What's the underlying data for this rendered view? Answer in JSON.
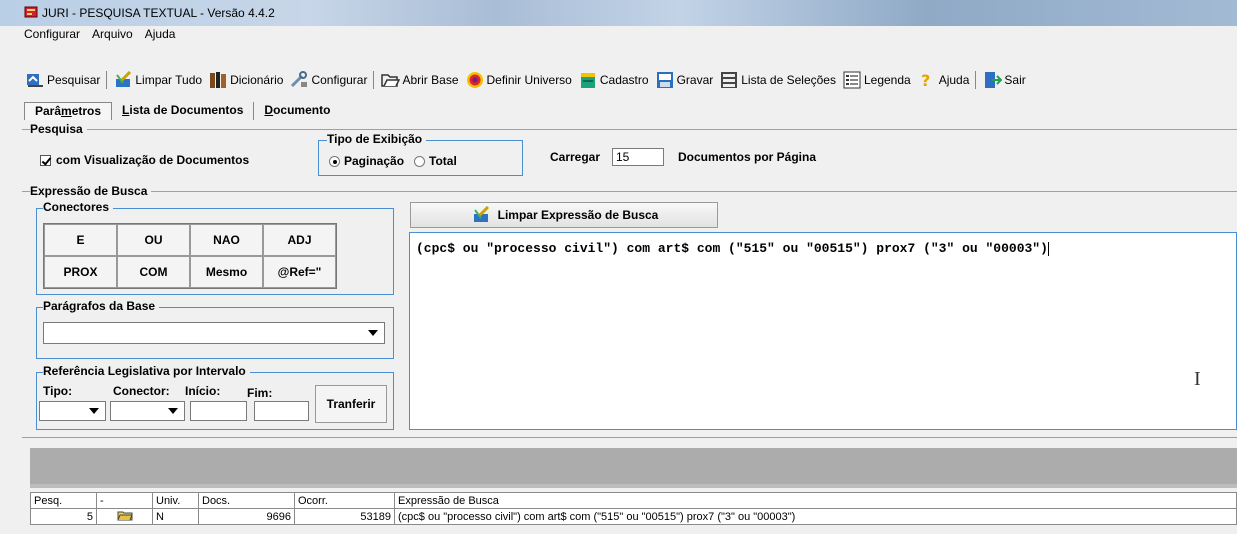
{
  "window": {
    "title": "JURI - PESQUISA TEXTUAL - Versão 4.4.2"
  },
  "menu": [
    "Configurar",
    "Arquivo",
    "Ajuda"
  ],
  "toolbar": [
    {
      "label": "Pesquisar",
      "icon": "search-icon"
    },
    {
      "label": "Limpar Tudo",
      "icon": "broom-icon"
    },
    {
      "label": "Dicionário",
      "icon": "books-icon"
    },
    {
      "label": "Configurar",
      "icon": "tools-icon"
    },
    {
      "label": "Abrir Base",
      "icon": "folder-open-icon"
    },
    {
      "label": "Definir Universo",
      "icon": "target-icon"
    },
    {
      "label": "Cadastro",
      "icon": "cabinet-icon"
    },
    {
      "label": "Gravar",
      "icon": "save-icon"
    },
    {
      "label": "Lista de Seleções",
      "icon": "selection-list-icon"
    },
    {
      "label": "Legenda",
      "icon": "legend-icon"
    },
    {
      "label": "Ajuda",
      "icon": "help-icon"
    },
    {
      "label": "Sair",
      "icon": "exit-icon"
    }
  ],
  "tabs": {
    "parametros": {
      "pre": "Parâ",
      "u": "m",
      "post": "etros"
    },
    "lista": {
      "pre": "",
      "u": "L",
      "post": "ista de Documentos"
    },
    "documento": {
      "pre": "",
      "u": "D",
      "post": "ocumento"
    }
  },
  "pesquisa": {
    "label": "Pesquisa",
    "checkbox_label": "com Visualização de Documentos",
    "checkbox_checked": true,
    "tipo_label": "Tipo de Exibição",
    "radio_paginacao": "Paginação",
    "radio_total": "Total",
    "selected": "Paginação",
    "carregar_label": "Carregar",
    "carregar_value": "15",
    "docs_por_pagina": "Documentos por Página"
  },
  "expressao": {
    "label": "Expressão de Busca",
    "conectores_label": "Conectores",
    "conectores": [
      "E",
      "OU",
      "NAO",
      "ADJ",
      "PROX",
      "COM",
      "Mesmo",
      "@Ref=\""
    ],
    "paragrafos_label": "Parágrafos da Base",
    "paragrafos_value": "",
    "referencia_label": "Referência Legislativa por Intervalo",
    "tipo_label": "Tipo:",
    "conector_label": "Conector:",
    "inicio_label": "Início:",
    "fim_label": "Fim:",
    "tranferir_label": "Tranferir",
    "limpar_label": "Limpar Expressão de Busca",
    "query": "(cpc$ ou \"processo civil\") com art$ com (\"515\" ou \"00515\") prox7 (\"3\" ou \"00003\")"
  },
  "results": {
    "columns": [
      "Pesq.",
      "-",
      "Univ.",
      "Docs.",
      "Ocorr.",
      "Expressão de Busca"
    ],
    "rows": [
      {
        "pesq": "5",
        "univ": "N",
        "docs": "9696",
        "ocorr": "53189",
        "expr": "(cpc$ ou \"processo civil\") com art$ com (\"515\" ou \"00515\") prox7 (\"3\" ou \"00003\")"
      }
    ]
  }
}
